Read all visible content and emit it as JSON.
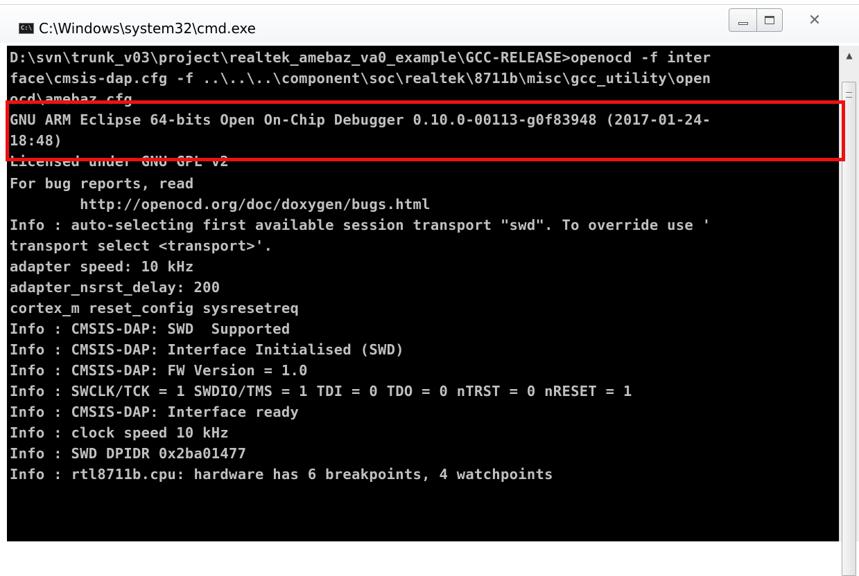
{
  "window": {
    "title": "C:\\Windows\\system32\\cmd.exe",
    "icon": "cmd-icon",
    "icon_text": "C:\\",
    "controls": {
      "minimize": "minimize-icon",
      "maximize": "maximize-icon",
      "close_glyph": "✕"
    }
  },
  "console": {
    "lines": [
      "D:\\svn\\trunk_v03\\project\\realtek_amebaz_va0_example\\GCC-RELEASE>openocd -f inter",
      "face\\cmsis-dap.cfg -f ..\\..\\..\\component\\soc\\realtek\\8711b\\misc\\gcc_utility\\open",
      "ocd\\amebaz.cfg",
      "GNU ARM Eclipse 64-bits Open On-Chip Debugger 0.10.0-00113-g0f83948 (2017-01-24-",
      "18:48)",
      "Licensed under GNU GPL v2",
      "For bug reports, read",
      "        http://openocd.org/doc/doxygen/bugs.html",
      "Info : auto-selecting first available session transport \"swd\". To override use '",
      "transport select <transport>'.",
      "adapter speed: 10 kHz",
      "adapter_nsrst_delay: 200",
      "cortex_m reset_config sysresetreq",
      "Info : CMSIS-DAP: SWD  Supported",
      "Info : CMSIS-DAP: Interface Initialised (SWD)",
      "Info : CMSIS-DAP: FW Version = 1.0",
      "Info : SWCLK/TCK = 1 SWDIO/TMS = 1 TDI = 0 TDO = 0 nTRST = 0 nRESET = 1",
      "Info : CMSIS-DAP: Interface ready",
      "Info : clock speed 10 kHz",
      "Info : SWD DPIDR 0x2ba01477",
      "Info : rtl8711b.cpu: hardware has 6 breakpoints, 4 watchpoints"
    ]
  },
  "colors": {
    "console_bg": "#000000",
    "console_text": "#c0c0c0",
    "highlight": "#ee1111"
  }
}
